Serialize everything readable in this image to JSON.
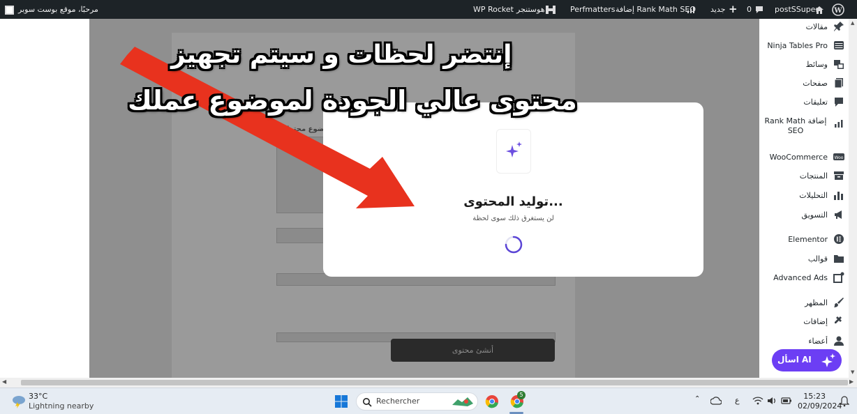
{
  "admin_bar": {
    "site_name": "postSSuper",
    "comments_count": "0",
    "new_label": "جديد",
    "rank_math": "إضافة Rank Math SEO",
    "perfmatters": "Perfmatters",
    "hostinger": "هوستنجر",
    "wp_rocket": "WP Rocket",
    "greeting": "مرحبًا، موقع بوست سوبر"
  },
  "sidebar": {
    "items": [
      {
        "label": "مقالات",
        "icon": "pin-icon"
      },
      {
        "label": "Ninja Tables Pro",
        "icon": "table-icon"
      },
      {
        "label": "وسائط",
        "icon": "media-icon"
      },
      {
        "label": "صفحات",
        "icon": "pages-icon"
      },
      {
        "label": "تعليقات",
        "icon": "comment-icon"
      },
      {
        "label": "إضافة Rank Math SEO",
        "icon": "chart-icon"
      },
      {
        "label": "WooCommerce",
        "icon": "woo-icon"
      },
      {
        "label": "المنتجات",
        "icon": "archive-icon"
      },
      {
        "label": "التحليلات",
        "icon": "bar-chart-icon"
      },
      {
        "label": "التسويق",
        "icon": "megaphone-icon"
      },
      {
        "label": "Elementor",
        "icon": "elementor-icon"
      },
      {
        "label": "قوالب",
        "icon": "folder-icon"
      },
      {
        "label": "Advanced Ads",
        "icon": "ads-icon"
      },
      {
        "label": "المظهر",
        "icon": "brush-icon"
      },
      {
        "label": "إضافات",
        "icon": "plugin-icon"
      },
      {
        "label": "أعضاء",
        "icon": "user-icon"
      }
    ],
    "ask_ai": "اسأل AI"
  },
  "background_form": {
    "question": "ما هو موضوع محتواك؟",
    "generate_button": "أنشئ محتوى"
  },
  "modal": {
    "title": "توليد المحتوى...",
    "subtitle": "لن يستغرق ذلك سوى لحظة"
  },
  "overlay_caption": {
    "line1": "إنتضر لحظات و سيتم تجهيز",
    "line2": "محتوى عالي الجودة لموضوع عملك"
  },
  "taskbar": {
    "temperature": "33°C",
    "weather": "Lightning nearby",
    "search_placeholder": "Rechercher",
    "chrome_badge": "5",
    "lang": "ع",
    "time": "15:23",
    "date": "02/09/2024"
  },
  "colors": {
    "admin_bar": "#1d2327",
    "accent_purple": "#6c3ef4",
    "arrow_red": "#e8321e"
  }
}
